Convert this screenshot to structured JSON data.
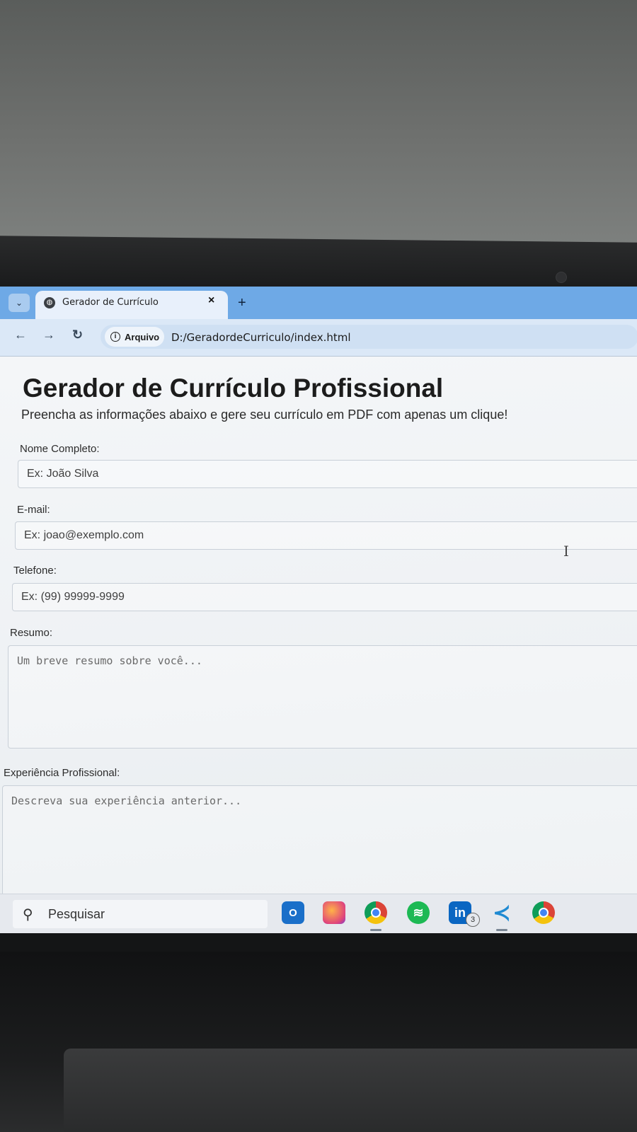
{
  "browser": {
    "tab_title": "Gerador de Currículo",
    "tab_close": "×",
    "new_tab": "+",
    "tab_menu": "⌄",
    "site_chip": "Arquivo",
    "url": "D:/GeradordeCurriculo/index.html"
  },
  "page": {
    "title": "Gerador de Currículo Profissional",
    "subtitle": "Preencha as informações abaixo e gere seu currículo em PDF com apenas um clique!"
  },
  "form": {
    "name": {
      "label": "Nome Completo:",
      "placeholder": "Ex: João Silva"
    },
    "email": {
      "label": "E-mail:",
      "placeholder": "Ex: joao@exemplo.com"
    },
    "phone": {
      "label": "Telefone:",
      "placeholder": "Ex: (99) 99999-9999"
    },
    "summary": {
      "label": "Resumo:",
      "placeholder": "Um breve resumo sobre você..."
    },
    "experience": {
      "label": "Experiência Profissional:",
      "placeholder": "Descreva sua experiência anterior..."
    }
  },
  "taskbar": {
    "search_placeholder": "Pesquisar",
    "linkedin_badge": "3",
    "apps": [
      "outlook-icon",
      "firefox-icon",
      "chrome-icon",
      "spotify-icon",
      "linkedin-icon",
      "vscode-icon",
      "chrome-icon"
    ]
  },
  "colors": {
    "tab_strip": "#6ea9e6",
    "toolbar": "#dbe8f7",
    "page_background": "#f2f4f6",
    "taskbar": "#e6e9ee"
  }
}
